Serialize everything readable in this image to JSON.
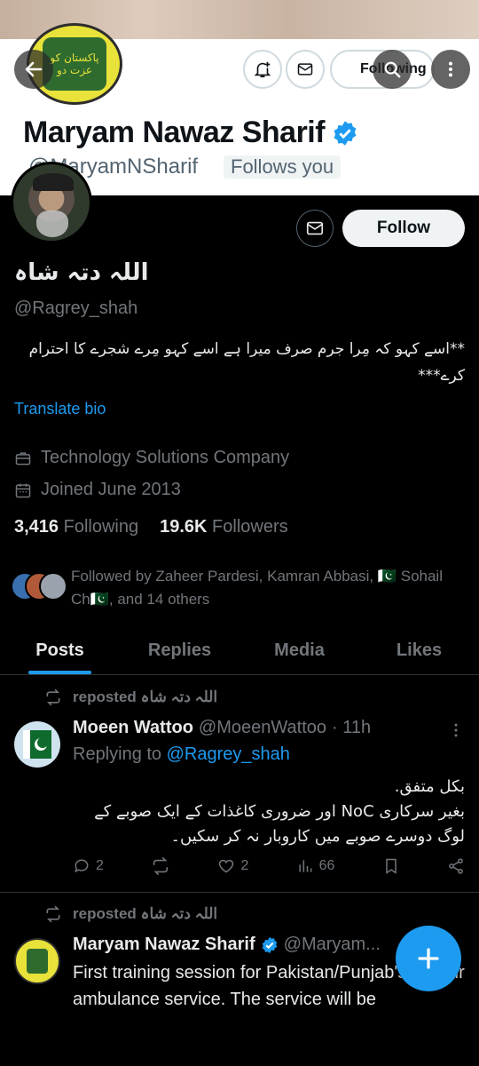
{
  "header": {
    "cover_name": "Maryam Nawaz Sharif",
    "cover_handle": "@MaryamNSharif",
    "follows_you": "Follows you",
    "following_label": "Following",
    "banner_logo_text": "پاکستان کو عزت دو"
  },
  "profile": {
    "display_name": "اللہ دتہ شاہ",
    "handle": "@Ragrey_shah",
    "bio": "**اسے کہو کہ مِرا جرم صرف میرا ہے اسے کہو مِرے شجرے کا احترام کرے***",
    "translate_bio": "Translate bio",
    "work": "Technology Solutions Company",
    "joined": "Joined June 2013",
    "following_count": "3,416",
    "following_label": "Following",
    "followers_count": "19.6K",
    "followers_label": "Followers",
    "followed_by": "Followed by Zaheer Pardesi, Kamran Abbasi, 🇵🇰 Sohail Ch🇵🇰, and 14 others",
    "follow_label": "Follow"
  },
  "tabs": [
    "Posts",
    "Replies",
    "Media",
    "Likes"
  ],
  "posts": [
    {
      "repost_label": "reposted اللہ دتہ شاہ",
      "author": "Moeen Wattoo",
      "handle": "@MoeenWattoo",
      "time": "· 11h",
      "replying_prefix": "Replying to",
      "replying_to": "@Ragrey_shah",
      "text": "بکل متفق.\nبغیر سرکاری NoC اور ضروری کاغذات کے ایک صوبے کے لوگ دوسرے صوبے میں کاروبار نہ کر سکیں۔",
      "replies": "2",
      "likes": "2",
      "views": "66"
    },
    {
      "repost_label": "reposted اللہ دتہ شاہ",
      "author": "Maryam Nawaz Sharif",
      "handle": "@Maryam...",
      "text": "First training session for Pakistan/Punjab's first air ambulance service. The service will be"
    }
  ],
  "colors": {
    "accent": "#1d9bf0",
    "muted": "#71767b",
    "text": "#e7e9ea"
  }
}
